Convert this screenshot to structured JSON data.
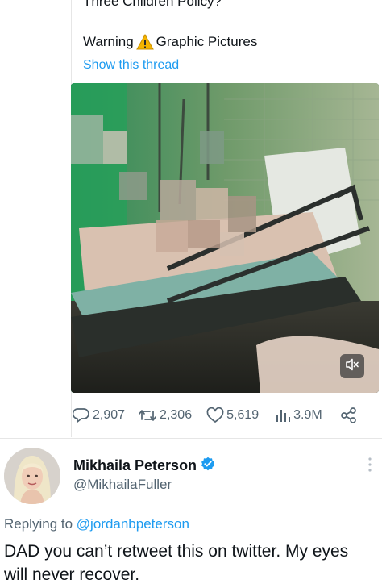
{
  "quoted_tweet": {
    "cut_title": "Three Children Policy?",
    "warning_prefix": "Warning",
    "warning_suffix": "Graphic Pictures",
    "show_thread": "Show this thread"
  },
  "metrics": {
    "replies": "2,907",
    "retweets": "2,306",
    "likes": "5,619",
    "views": "3.9M"
  },
  "reply_tweet": {
    "author_name": "Mikhaila Peterson",
    "handle": "@MikhailaFuller",
    "replying_prefix": "Replying to",
    "replying_to": "@jordanbpeterson",
    "text": "DAD you can’t retweet this on twitter. My eyes will never recover."
  },
  "colors": {
    "accent": "#1d9bf0",
    "secondary_text": "#536471",
    "verified": "#1d9bf0",
    "warning": "#f5b400"
  },
  "icons": [
    "warning-icon",
    "mute-icon",
    "reply-icon",
    "retweet-icon",
    "like-icon",
    "views-icon",
    "share-icon",
    "verified-badge-icon",
    "more-icon"
  ]
}
